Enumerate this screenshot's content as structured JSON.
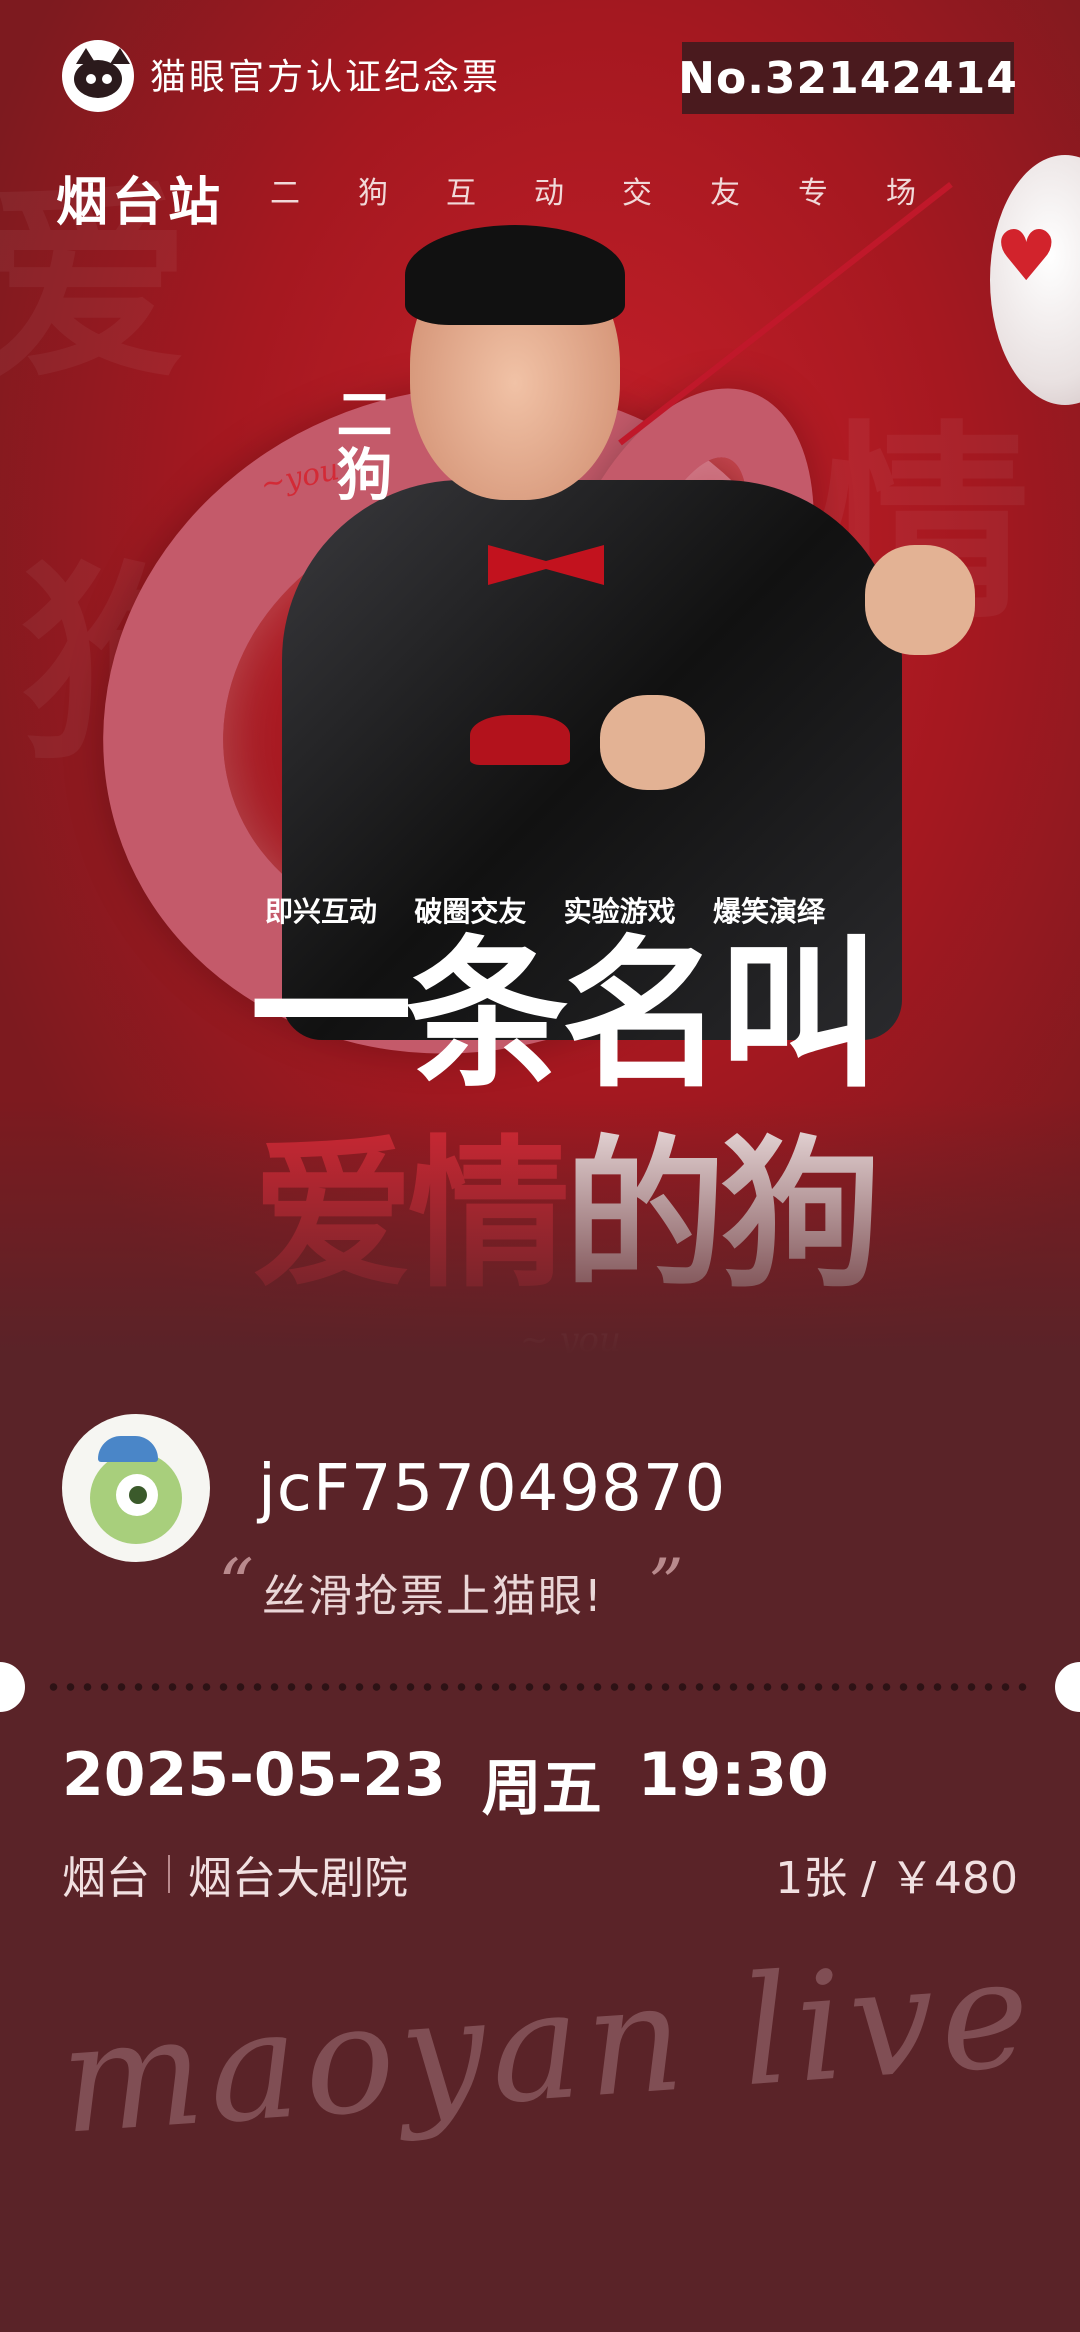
{
  "header": {
    "brand_title": "猫眼官方认证纪念票",
    "serial_number": "No.32142414"
  },
  "poster": {
    "station": "烟台站",
    "subtitle": "二狗互动交友专场",
    "performer_name": "二狗",
    "taglines": [
      "即兴互动",
      "破圈交友",
      "实验游戏",
      "爆笑演绎"
    ],
    "headline_line1": "一条名叫",
    "headline_line2_red": "爱情",
    "headline_line2_white": "的狗"
  },
  "user": {
    "username": "jcF757049870",
    "slogan": "丝滑抢票上猫眼!"
  },
  "event": {
    "date": "2025-05-23",
    "weekday": "周五",
    "time": "19:30",
    "city": "烟台",
    "venue": "烟台大剧院",
    "quantity_price": "1张 / ￥480"
  },
  "watermark": "maoyan live",
  "colors": {
    "ticket_background": "#5a2328",
    "poster_red": "#a51820",
    "headline_red": "#d52834"
  },
  "icons": [
    "maoyan-cat-logo-icon",
    "avatar-monster-icon"
  ]
}
